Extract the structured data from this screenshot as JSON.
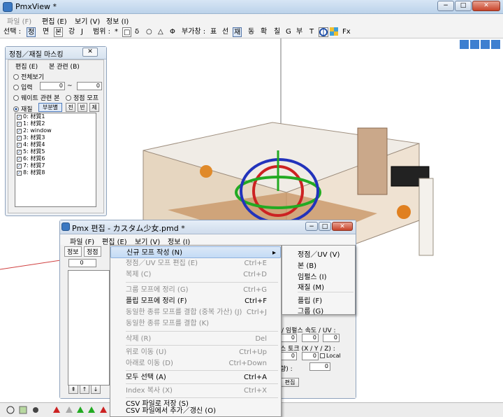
{
  "main": {
    "title": "PmxView *",
    "menus": [
      "파일 (F)",
      "편집 (E)",
      "보기 (V)",
      "정보 (I)"
    ],
    "toolbar": {
      "select_label": "선택 :",
      "select_modes": [
        "정",
        "면",
        "본",
        "강",
        "J"
      ],
      "range_label": "범위 :",
      "range_modes": [
        "*",
        "□",
        "δ",
        "○",
        "△",
        "Φ"
      ],
      "window_label": "부가창 :",
      "window_modes": [
        "표",
        "선",
        "재",
        "동",
        "확",
        "칠",
        "G",
        "부",
        "T"
      ],
      "fx": "Fx"
    }
  },
  "mask_panel": {
    "title": "정점／재질 마스킹",
    "close": "✕",
    "menus": [
      "편집 (E)",
      "본 관련 (B)"
    ],
    "options": [
      "전체보기",
      "입력",
      "웨이트 관련 본",
      "정점 모프",
      "재질"
    ],
    "input_from": "0",
    "input_sep": "~",
    "input_to": "0",
    "buttons": [
      "부분별",
      "전",
      "반",
      "제"
    ],
    "materials": [
      "0: 材質1",
      "1: 材質2",
      "2: window",
      "3: 材質3",
      "4: 材質4",
      "5: 材質5",
      "6: 材質6",
      "7: 材質7",
      "8: 材質8"
    ]
  },
  "edit_window": {
    "title": "Pmx 편집 - カスタム少女.pmd *",
    "menus": [
      "파일 (F)",
      "편집 (E)",
      "보기 (V)",
      "정보 (I)"
    ],
    "tabs": [
      "정보",
      "정점"
    ],
    "index_value": "0",
    "speed_label": "/ 임펄스 속도 / UV :",
    "torque_label": "스 토크 (X / Y / Z) :",
    "local_label": "Local",
    "dir_label": "향) :",
    "edit_button": "편집",
    "zero": "0"
  },
  "edit_menu": {
    "items": [
      {
        "label": "신규 모프 작성 (N)",
        "shortcut": "",
        "disabled": false
      },
      {
        "label": "정점／UV 모프 편집 (E)",
        "shortcut": "Ctrl+E",
        "disabled": true
      },
      {
        "label": "복제 (C)",
        "shortcut": "Ctrl+D",
        "disabled": true
      },
      {
        "label": "그룹 모프에 정리 (G)",
        "shortcut": "Ctrl+G",
        "disabled": true
      },
      {
        "label": "플립 모프에 정리 (F)",
        "shortcut": "Ctrl+F",
        "disabled": false
      },
      {
        "label": "동일한 종류 모프를 결합 (중복 가산) (J)",
        "shortcut": "Ctrl+J",
        "disabled": true
      },
      {
        "label": "동일한 종류 모프를 결합 (K)",
        "shortcut": "",
        "disabled": true
      },
      {
        "label": "삭제 (R)",
        "shortcut": "Del",
        "disabled": true
      },
      {
        "label": "위로 이동 (U)",
        "shortcut": "Ctrl+Up",
        "disabled": true
      },
      {
        "label": "아래로 이동 (D)",
        "shortcut": "Ctrl+Down",
        "disabled": true
      },
      {
        "label": "모두 선택 (A)",
        "shortcut": "Ctrl+A",
        "disabled": false
      },
      {
        "label": "Index 복사 (X)",
        "shortcut": "Ctrl+X",
        "disabled": true
      },
      {
        "label": "CSV 파일로 저장 (S)",
        "shortcut": "",
        "disabled": false
      },
      {
        "label": "CSV 파일에서 추가／갱신 (O)",
        "shortcut": "",
        "disabled": false
      }
    ],
    "arrow": "▸"
  },
  "submenu": {
    "items": [
      "정점／UV (V)",
      "본 (B)",
      "임펄스 (I)",
      "재질 (M)",
      "플립 (F)",
      "그룹 (G)"
    ]
  }
}
